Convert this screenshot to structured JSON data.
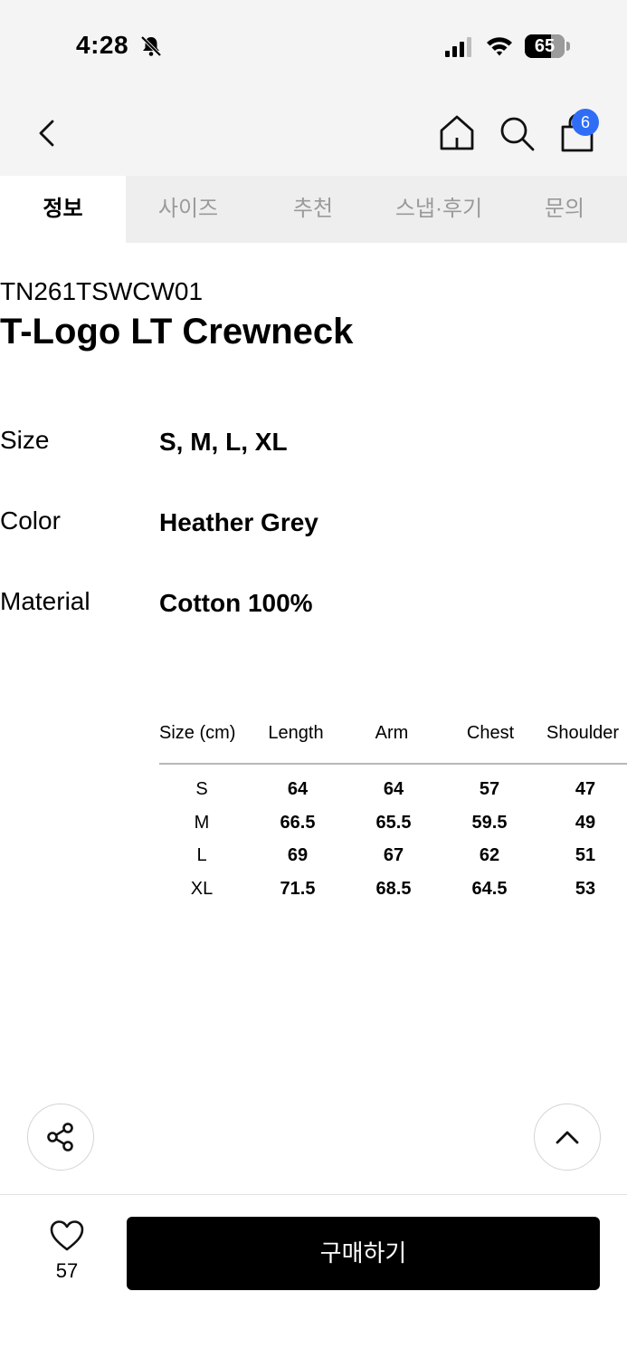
{
  "status_bar": {
    "time": "4:28",
    "battery": "65",
    "battery_fraction": 0.65
  },
  "nav": {
    "back_icon": "chevron-left-icon",
    "home_icon": "home-icon",
    "search_icon": "search-icon",
    "bag_icon": "shopping-bag-icon",
    "cart_badge": "6",
    "badge_color": "#2f6df6"
  },
  "tabs": [
    {
      "label": "정보",
      "active": true
    },
    {
      "label": "사이즈",
      "active": false
    },
    {
      "label": "추천",
      "active": false
    },
    {
      "label": "스냅·후기",
      "active": false
    },
    {
      "label": "문의",
      "active": false
    }
  ],
  "product": {
    "code": "TN261TSWCW01",
    "name": "T-Logo LT Crewneck"
  },
  "specs": [
    {
      "label": "Size",
      "value": "S, M, L, XL"
    },
    {
      "label": "Color",
      "value": "Heather Grey"
    },
    {
      "label": "Material",
      "value": "Cotton 100%"
    }
  ],
  "size_table": {
    "headers": [
      "Size (cm)",
      "Length",
      "Arm",
      "Chest",
      "Shoulder"
    ],
    "rows": [
      [
        "S",
        "64",
        "64",
        "57",
        "47"
      ],
      [
        "M",
        "66.5",
        "65.5",
        "59.5",
        "49"
      ],
      [
        "L",
        "69",
        "67",
        "62",
        "51"
      ],
      [
        "XL",
        "71.5",
        "68.5",
        "64.5",
        "53"
      ]
    ]
  },
  "bottom": {
    "like_count": "57",
    "buy_label": "구매하기",
    "share_icon": "share-icon",
    "scroll_top_icon": "chevron-up-icon",
    "heart_icon": "heart-icon"
  }
}
